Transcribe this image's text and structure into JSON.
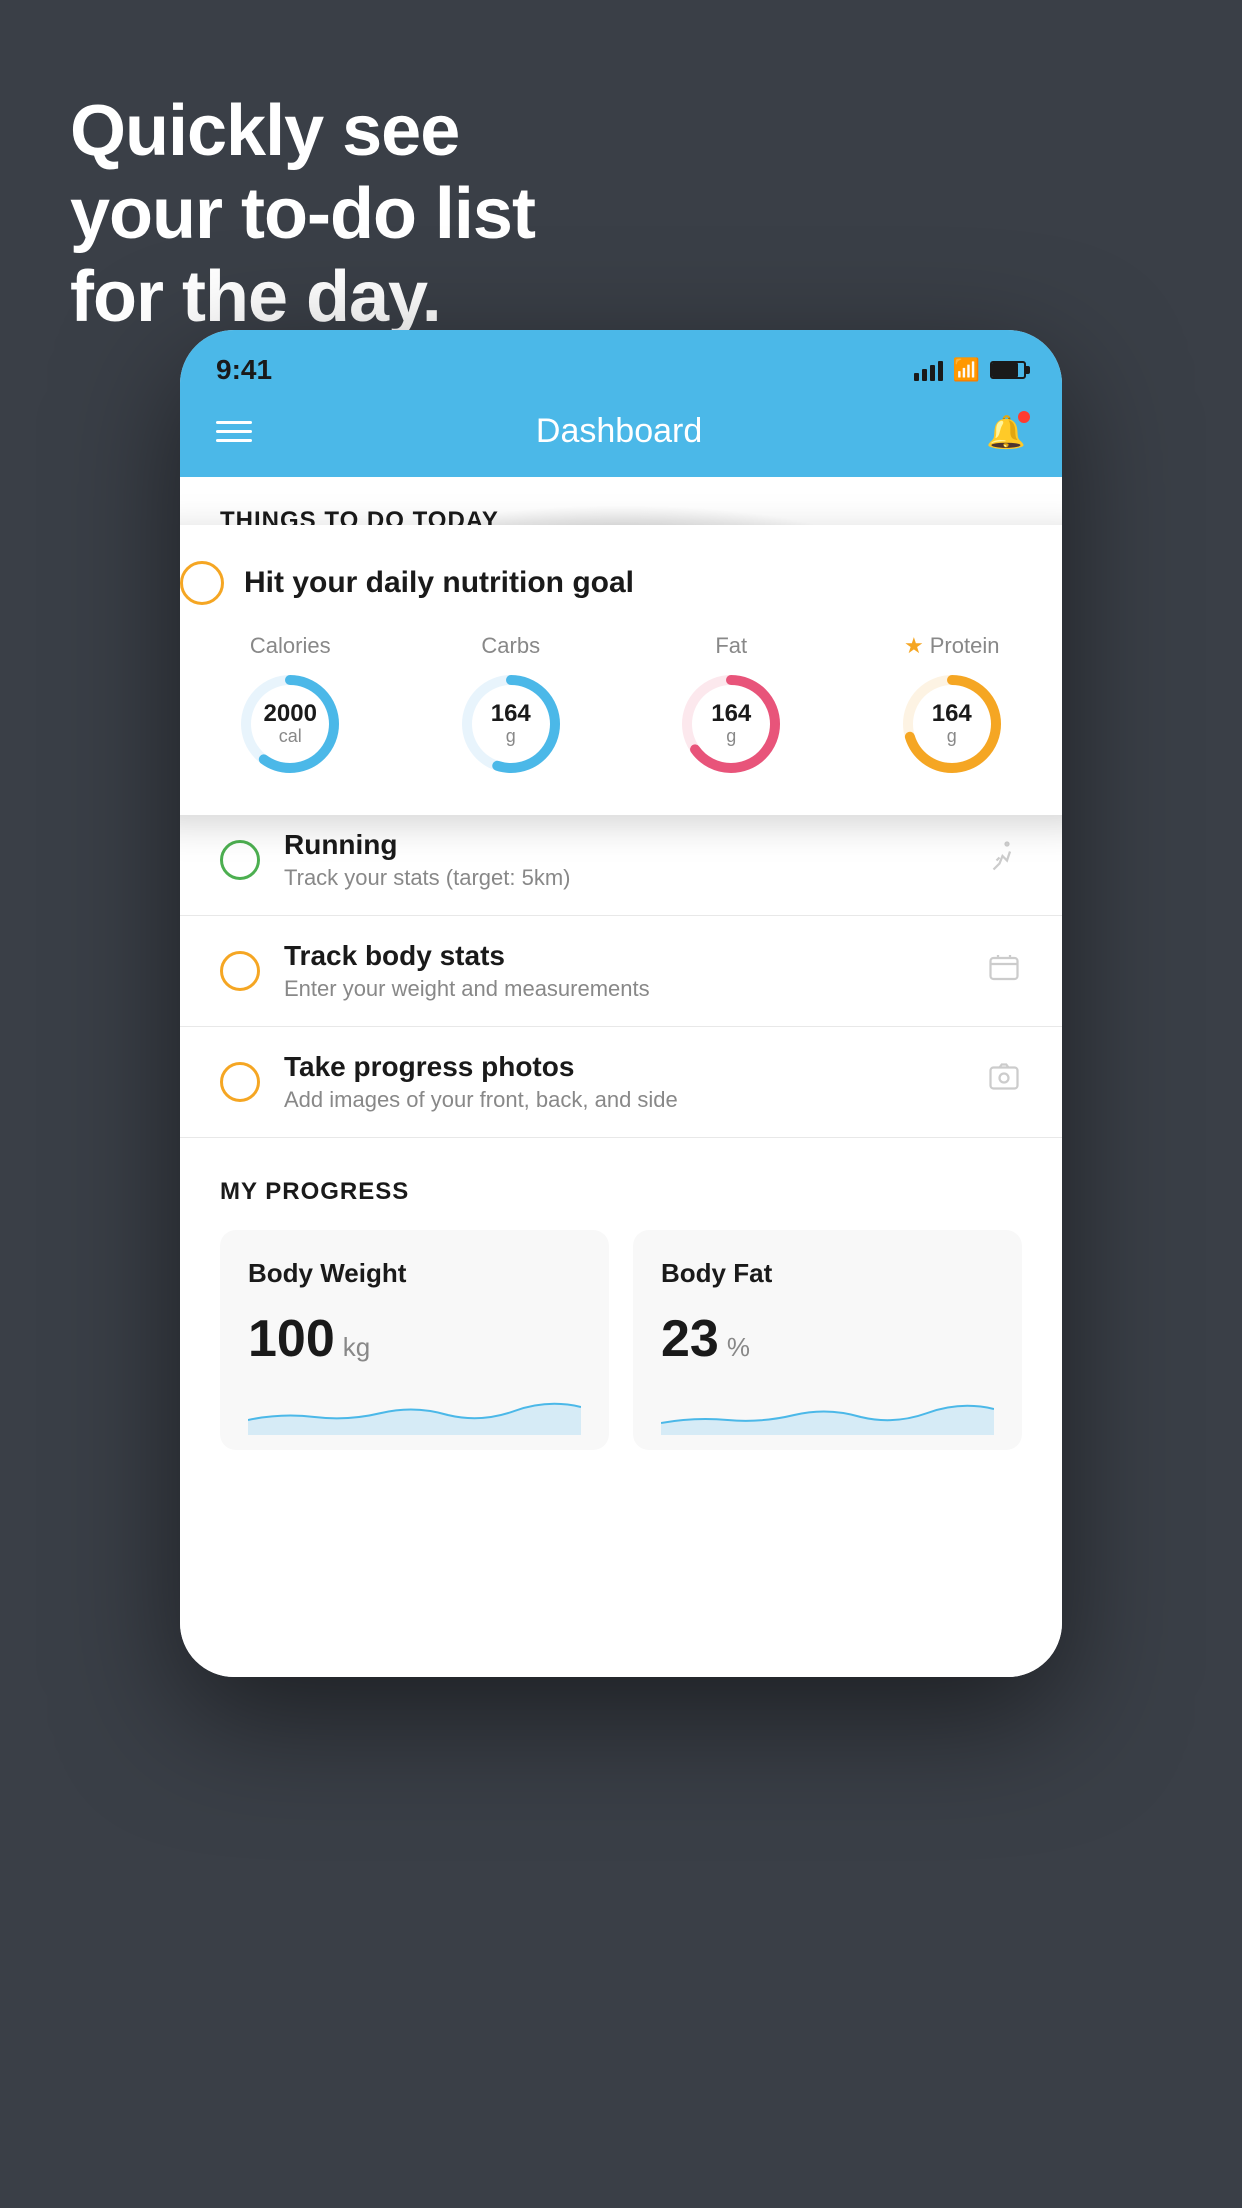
{
  "hero": {
    "line1": "Quickly see",
    "line2": "your to-do list",
    "line3": "for the day."
  },
  "status_bar": {
    "time": "9:41"
  },
  "header": {
    "title": "Dashboard"
  },
  "section": {
    "things_today": "THINGS TO DO TODAY"
  },
  "floating_card": {
    "title": "Hit your daily nutrition goal",
    "nutrition": [
      {
        "label": "Calories",
        "value": "2000",
        "unit": "cal",
        "color": "#4bb8e8",
        "percent": 60
      },
      {
        "label": "Carbs",
        "value": "164",
        "unit": "g",
        "color": "#4bb8e8",
        "percent": 55
      },
      {
        "label": "Fat",
        "value": "164",
        "unit": "g",
        "color": "#e8547a",
        "percent": 65
      },
      {
        "label": "Protein",
        "value": "164",
        "unit": "g",
        "color": "#f5a623",
        "percent": 70,
        "starred": true
      }
    ]
  },
  "todo_items": [
    {
      "title": "Running",
      "subtitle": "Track your stats (target: 5km)",
      "circle_color": "green",
      "icon": "shoe"
    },
    {
      "title": "Track body stats",
      "subtitle": "Enter your weight and measurements",
      "circle_color": "yellow",
      "icon": "scale"
    },
    {
      "title": "Take progress photos",
      "subtitle": "Add images of your front, back, and side",
      "circle_color": "yellow",
      "icon": "photo"
    }
  ],
  "progress": {
    "section_title": "MY PROGRESS",
    "cards": [
      {
        "title": "Body Weight",
        "value": "100",
        "unit": "kg"
      },
      {
        "title": "Body Fat",
        "value": "23",
        "unit": "%"
      }
    ]
  }
}
